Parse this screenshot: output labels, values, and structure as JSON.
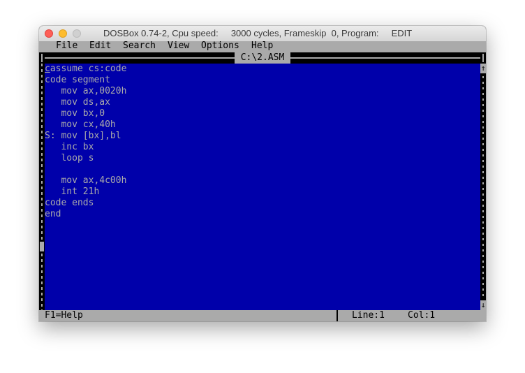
{
  "window": {
    "title": "DOSBox 0.74-2, Cpu speed:     3000 cycles, Frameskip  0, Program:     EDIT"
  },
  "menu": {
    "items": [
      "File",
      "Edit",
      "Search",
      "View",
      "Options",
      "Help"
    ]
  },
  "editor": {
    "filename": "C:\\2.ASM",
    "cursor_char": "c",
    "first_line_rest": "assume cs:code",
    "lines": [
      "code segment",
      "   mov ax,0020h",
      "   mov ds,ax",
      "   mov bx,0",
      "   mov cx,40h",
      "S: mov [bx],bl",
      "   inc bx",
      "   loop s",
      "",
      "   mov ax,4c00h",
      "   int 21h",
      "code ends",
      "end"
    ],
    "scroll_up_glyph": "↑",
    "scroll_down_glyph": "↓"
  },
  "status": {
    "help": "F1=Help",
    "line": "Line:1",
    "col": "Col:1"
  },
  "colors": {
    "editor_bg": "#0000aa",
    "text": "#aaaaaa",
    "bar_bg": "#aaaaaa"
  }
}
